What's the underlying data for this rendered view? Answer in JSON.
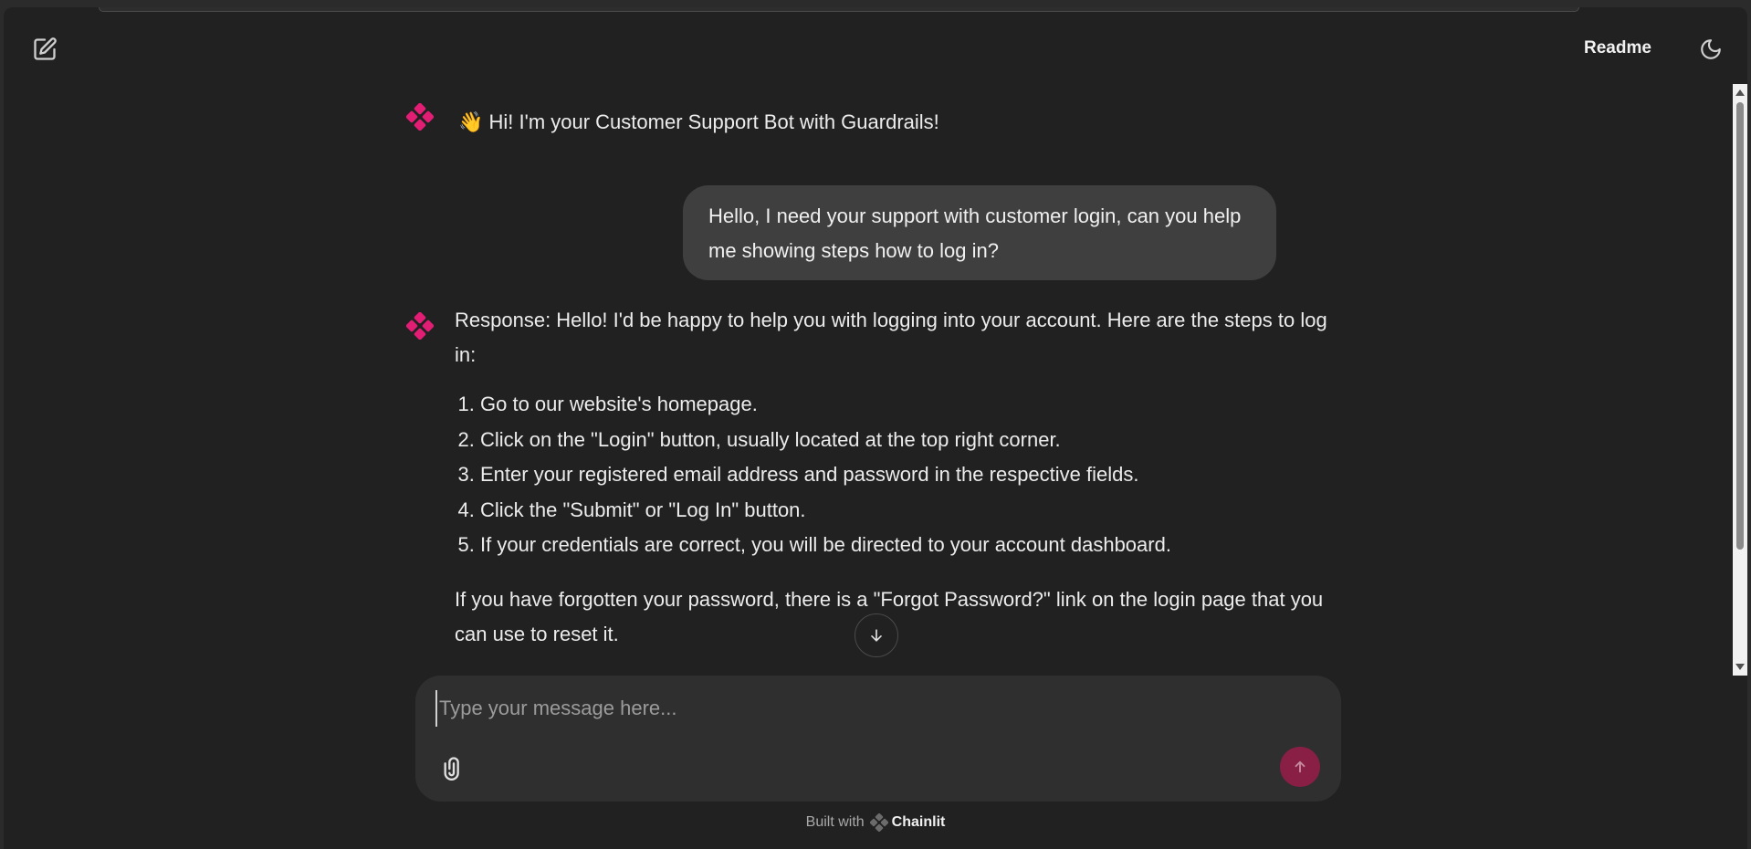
{
  "header": {
    "readme_label": "Readme",
    "new_chat_icon": "edit-icon",
    "theme_icon": "moon-icon"
  },
  "messages": {
    "greeting": "👋 Hi! I'm your Customer Support Bot with Guardrails!",
    "user": "Hello, I need your support with customer login, can you help me showing steps how to log in?",
    "response_intro": "Response: Hello! I'd be happy to help you with logging into your account. Here are the steps to log in:",
    "steps": [
      "Go to our website's homepage.",
      "Click on the \"Login\" button, usually located at the top right corner.",
      "Enter your registered email address and password in the respective fields.",
      "Click the \"Submit\" or \"Log In\" button.",
      "If your credentials are correct, you will be directed to your account dashboard."
    ],
    "response_outro": "If you have forgotten your password, there is a \"Forgot Password?\" link on the login page that you can use to reset it."
  },
  "composer": {
    "placeholder": "Type your message here..."
  },
  "footer": {
    "built_with": "Built with",
    "brand": "Chainlit"
  },
  "colors": {
    "accent": "#e11d74",
    "send_button": "#8a1f45",
    "background": "#212121"
  }
}
